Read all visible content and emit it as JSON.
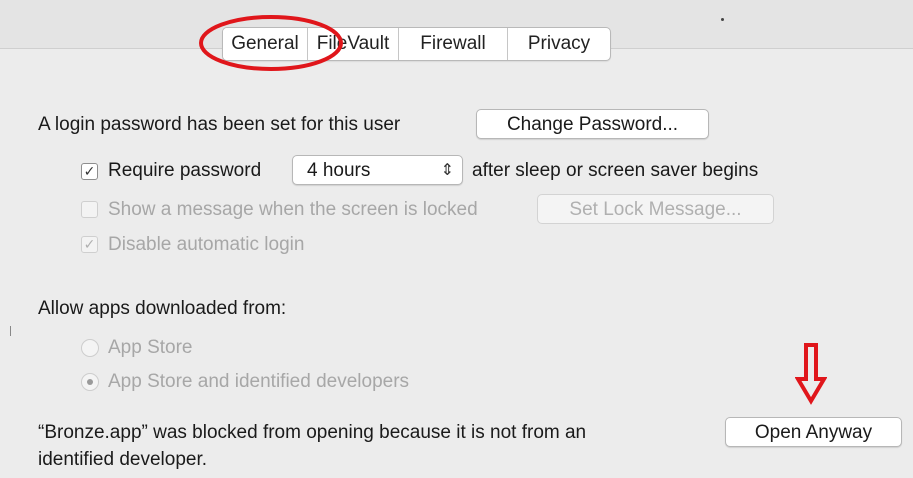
{
  "tabs": [
    {
      "label": "General",
      "selected": true
    },
    {
      "label": "FileVault",
      "selected": false
    },
    {
      "label": "Firewall",
      "selected": false
    },
    {
      "label": "Privacy",
      "selected": false
    }
  ],
  "login": {
    "label": "A login password has been set for this user",
    "change_password_button": "Change Password..."
  },
  "require_password": {
    "checked": true,
    "label": "Require password",
    "selected_interval": "4 hours",
    "suffix": "after sleep or screen saver begins"
  },
  "lock_message": {
    "checked": false,
    "label": "Show a message when the screen is locked",
    "button": "Set Lock Message..."
  },
  "auto_login": {
    "checked": true,
    "label": "Disable automatic login"
  },
  "allow_apps": {
    "label": "Allow apps downloaded from:",
    "options": [
      {
        "label": "App Store",
        "selected": false
      },
      {
        "label": "App Store and identified developers",
        "selected": true
      }
    ]
  },
  "blocked": {
    "line1": "“Bronze.app” was blocked from opening because it is not from an",
    "line2": "identified developer.",
    "open_anyway_button": "Open Anyway"
  },
  "icons": {
    "checkmark": "checkmark-icon",
    "stepper": "up-down-chevron-icon",
    "annotation_arrow": "down-arrow-icon",
    "annotation_circle": "circle-highlight"
  },
  "colors": {
    "annotation_red": "#e0161b",
    "background": "#ececec"
  }
}
